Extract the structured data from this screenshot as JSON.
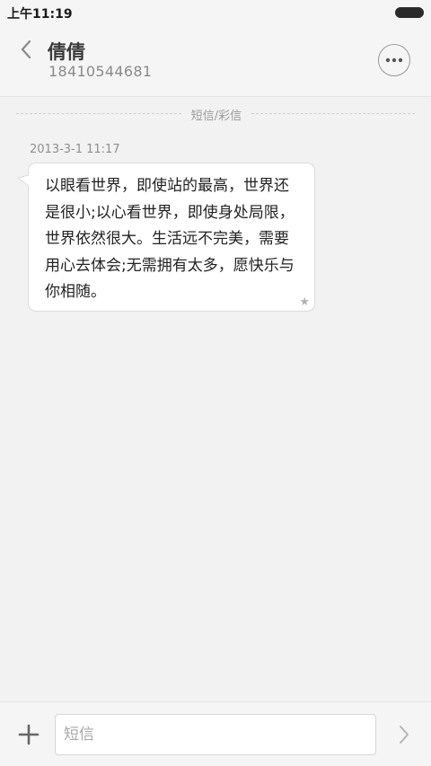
{
  "status_bar": {
    "time": "上午11:19",
    "battery_icon": "battery-full-icon"
  },
  "header": {
    "back_icon": "chevron-left-icon",
    "contact_name": "倩倩",
    "contact_number": "18410544681",
    "more_icon": "more-horizontal-icon"
  },
  "conversation": {
    "divider_label": "短信/彩信",
    "messages": [
      {
        "timestamp": "2013-3-1 11:17",
        "text": "以眼看世界，即使站的最高，世界还是很小;以心看世界，即使身处局限，世界依然很大。生活远不完美，需要用心去体会;无需拥有太多，愿快乐与你相随。",
        "status_icon": "star-icon"
      }
    ]
  },
  "composer": {
    "add_icon": "plus-icon",
    "input_value": "",
    "input_placeholder": "短信",
    "send_icon": "chevron-right-icon"
  },
  "colors": {
    "background": "#f2f2f2",
    "bubble": "#ffffff",
    "text_primary": "#222222",
    "text_secondary": "#8a8a8a"
  }
}
